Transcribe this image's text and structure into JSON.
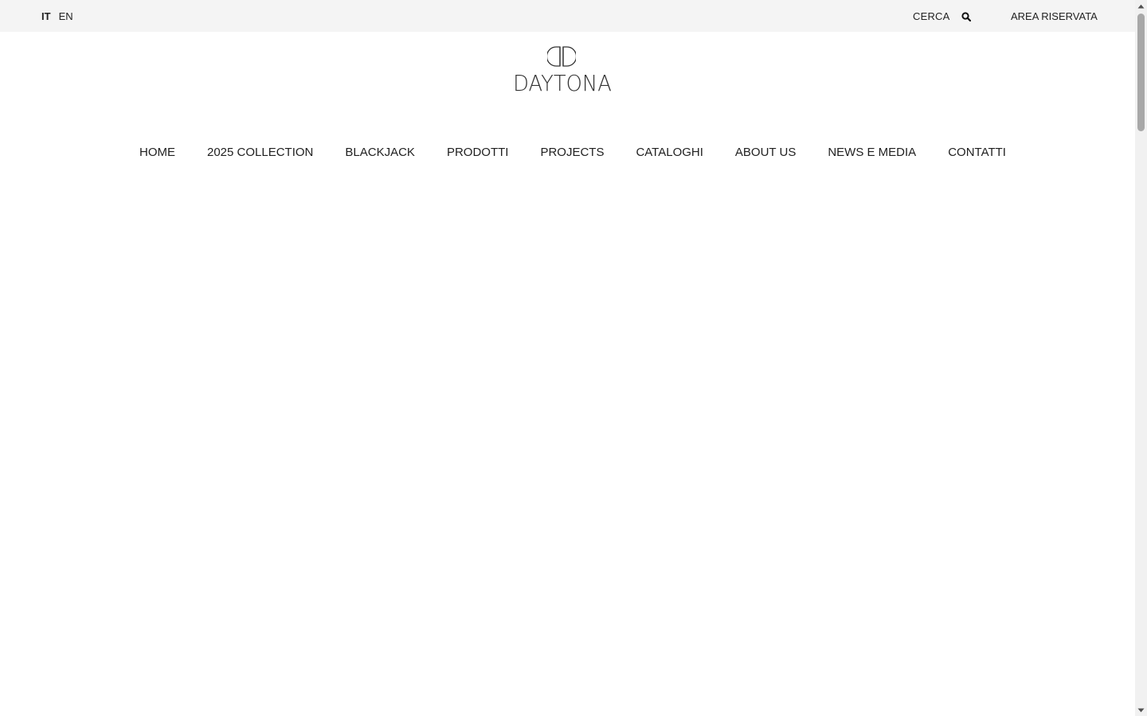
{
  "topbar": {
    "languages": [
      {
        "label": "IT",
        "active": true
      },
      {
        "label": "EN",
        "active": false
      }
    ],
    "search_label": "CERCA",
    "search_icon": "search-icon",
    "reserved_area_label": "AREA RISERVATA"
  },
  "logo": {
    "text": "DAYTONA",
    "icon": "daytona-monogram-icon"
  },
  "nav": {
    "items": [
      {
        "label": "HOME"
      },
      {
        "label": "2025 COLLECTION"
      },
      {
        "label": "BLACKJACK"
      },
      {
        "label": "PRODOTTI"
      },
      {
        "label": "PROJECTS"
      },
      {
        "label": "CATALOGHI"
      },
      {
        "label": "ABOUT US"
      },
      {
        "label": "NEWS E MEDIA"
      },
      {
        "label": "CONTATTI"
      }
    ]
  },
  "colors": {
    "topbar_bg": "#f4f4f4",
    "text": "#222222",
    "page_bg": "#ffffff"
  }
}
